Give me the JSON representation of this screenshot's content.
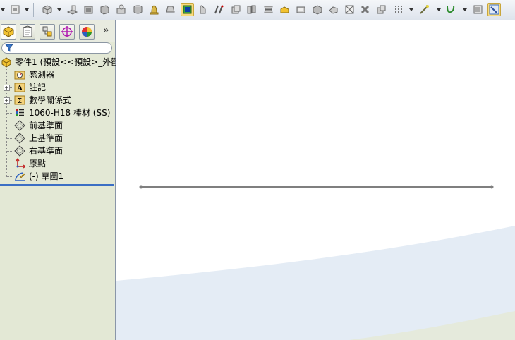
{
  "toolbar": {
    "icons": [
      "view-icon",
      "cube-icon",
      "extrude-icon",
      "revolve-icon",
      "boss-icon",
      "feature-icon",
      "shell-icon",
      "bell-icon",
      "loft-icon",
      "sketch-box-icon",
      "fillet-icon",
      "chamfer-icon",
      "rib-icon",
      "wrap-icon",
      "draft-icon",
      "dome-icon",
      "folder-icon",
      "mirror-icon",
      "pattern-icon",
      "cut-icon",
      "delete-face-icon",
      "move-icon",
      "linear-pattern-icon",
      "reference-icon",
      "curves-icon",
      "instant3d-icon",
      "rapid-sketch-icon"
    ]
  },
  "panel": {
    "tabs": [
      "featuremanager-tab",
      "propertymanager-tab",
      "configurationmanager-tab",
      "dimxpert-tab",
      "display-manager-tab"
    ],
    "more": "»"
  },
  "tree": {
    "root": "零件1  (預設<<預設>_外觀",
    "items": [
      {
        "label": "感測器",
        "icon": "sensor-icon"
      },
      {
        "label": "註記",
        "icon": "annotation-icon"
      },
      {
        "label": "數學關係式",
        "icon": "equation-icon"
      },
      {
        "label": "1060-H18 棒材 (SS)",
        "icon": "material-icon"
      },
      {
        "label": "前基準面",
        "icon": "plane-icon"
      },
      {
        "label": "上基準面",
        "icon": "plane-icon"
      },
      {
        "label": "右基準面",
        "icon": "plane-icon"
      },
      {
        "label": "原點",
        "icon": "origin-icon"
      },
      {
        "label": "(-) 草圖1",
        "icon": "sketch-icon"
      }
    ]
  },
  "colors": {
    "panel_bg": "#e3e8d5",
    "rollback_bar": "#3b6ec4",
    "sketch_line": "#7f7f7f",
    "background_blue": "#e4ecf5",
    "background_green": "#e5eadc"
  }
}
